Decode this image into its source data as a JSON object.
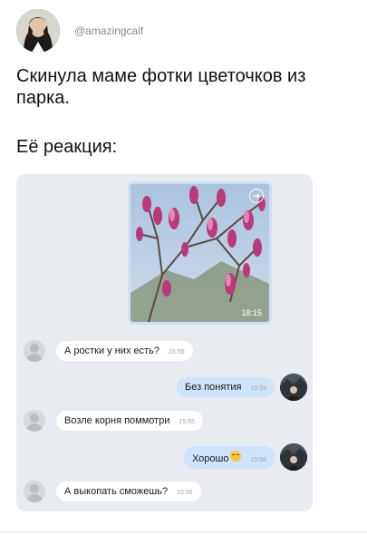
{
  "header": {
    "handle": "@amazingcalf"
  },
  "tweet": {
    "text": "Скинула маме фотки цветочков из парка.",
    "reaction": "Её реакция:"
  },
  "chat": {
    "photo_time": "18:15",
    "messages": [
      {
        "text": "А ростки у них есть?",
        "time": "15:55",
        "direction": "in"
      },
      {
        "text": "Без понятия",
        "time": "15:55",
        "direction": "out"
      },
      {
        "text": "Возле корня поммотри",
        "time": "15:55",
        "direction": "in"
      },
      {
        "text": "Хорошо",
        "time": "15:56",
        "direction": "out",
        "emoji": "relieved-face"
      },
      {
        "text": "А выкопать сможешь?",
        "time": "15:56",
        "direction": "in"
      }
    ]
  },
  "colors": {
    "chat_bg": "#e8ebef",
    "outgoing_bubble": "#cde4fb",
    "incoming_bubble": "#ffffff"
  }
}
